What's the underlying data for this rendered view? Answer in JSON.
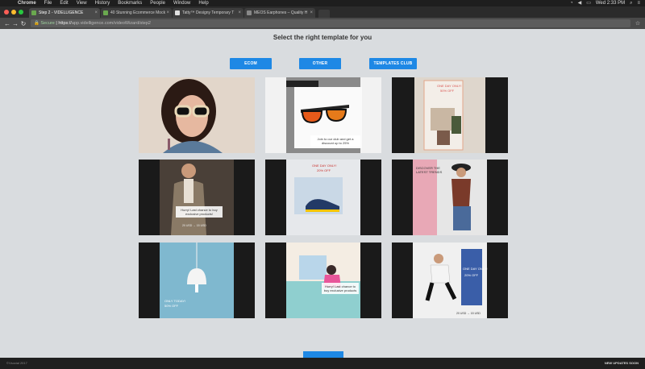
{
  "menubar": {
    "items": [
      "Chrome",
      "File",
      "Edit",
      "View",
      "History",
      "Bookmarks",
      "People",
      "Window",
      "Help"
    ],
    "clock": "Wed 2:33 PM"
  },
  "tabs": [
    {
      "label": "Step 2 - VIDELLIGENCE",
      "active": true
    },
    {
      "label": "40 Stunning Ecommerce Mock",
      "active": false
    },
    {
      "label": "Tatty™ Designy Temporary T",
      "active": false
    },
    {
      "label": "MEOS Earphones – Quality H",
      "active": false
    }
  ],
  "address": {
    "secure_label": "Secure",
    "prefix": "https://",
    "url": "app.videlligence.com/videoWizard/step2"
  },
  "page": {
    "title": "Select the right template for you"
  },
  "filters": [
    {
      "label": "ECOM"
    },
    {
      "label": "OTHER"
    },
    {
      "label": "TEMPLATES CLUB"
    }
  ],
  "cards": {
    "c2": {
      "caption": "Join to our club and get a discount up to 25%"
    },
    "c3": {
      "headline": "ONE DAY ONLY!",
      "sub": "50% OFF"
    },
    "c4": {
      "caption": "Hurry! Last chance to buy exclusive products!",
      "price": "20 USD → 15 USD"
    },
    "c5": {
      "headline": "ONE DAY ONLY!",
      "sub": "20% OFF"
    },
    "c6": {
      "headline": "DISCOVER THE LATEST TRENDS"
    },
    "c7": {
      "headline": "ONLY TODAY!",
      "sub": "50% OFF"
    },
    "c8": {
      "caption": "Hurry! Last chance to buy exclusive products"
    },
    "c9": {
      "headline": "ONE DAY ONLY!",
      "sub": "20% OFF",
      "price": "20 USD → 15 USD"
    }
  },
  "footer": {
    "copyright": "©Vsocial 2017",
    "right_label": "NEW UPDATES SOON"
  },
  "colors": {
    "accent": "#1e88e5",
    "background": "#d9dcdf",
    "dark": "#1a1a1a"
  }
}
